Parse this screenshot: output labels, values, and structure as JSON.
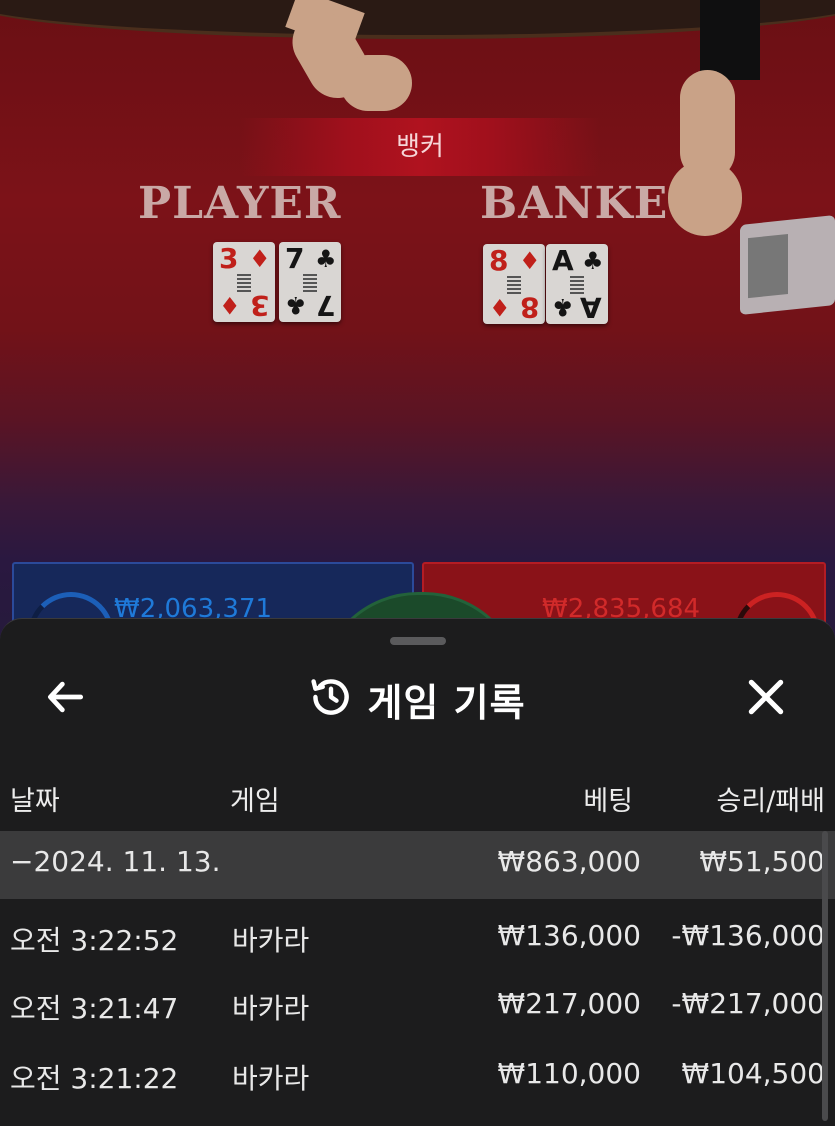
{
  "table": {
    "result_label": "뱅커",
    "player_label": "PLAYER",
    "banker_label": "BANKE",
    "player_cards": [
      {
        "rank": "3",
        "suit": "♦",
        "color": "red"
      },
      {
        "rank": "7",
        "suit": "♣",
        "color": "black"
      }
    ],
    "banker_cards": [
      {
        "rank": "8",
        "suit": "♦",
        "color": "red"
      },
      {
        "rank": "A",
        "suit": "♣",
        "color": "black"
      }
    ],
    "player_bet_total": "₩2,063,371",
    "banker_bet_total": "₩2,835,684"
  },
  "history": {
    "back_icon": "arrow-left-icon",
    "history_icon": "history-icon",
    "title": "게임 기록",
    "close_icon": "close-icon",
    "columns": {
      "date": "날짜",
      "game": "게임",
      "bet": "베팅",
      "win_loss": "승리/패배"
    },
    "group": {
      "date": "−2024. 11. 13.",
      "bet": "₩863,000",
      "win_loss": "₩51,500"
    },
    "rows": [
      {
        "time": "오전 3:22:52",
        "game": "바카라",
        "bet": "₩136,000",
        "win_loss": "-₩136,000"
      },
      {
        "time": "오전 3:21:47",
        "game": "바카라",
        "bet": "₩217,000",
        "win_loss": "-₩217,000"
      },
      {
        "time": "오전 3:21:22",
        "game": "바카라",
        "bet": "₩110,000",
        "win_loss": "₩104,500"
      }
    ]
  },
  "colors": {
    "sheet_bg": "#1c1c1d",
    "group_row_bg": "#3b3b3c",
    "player_blue": "#1f7ad9",
    "banker_red": "#d12a2a"
  }
}
